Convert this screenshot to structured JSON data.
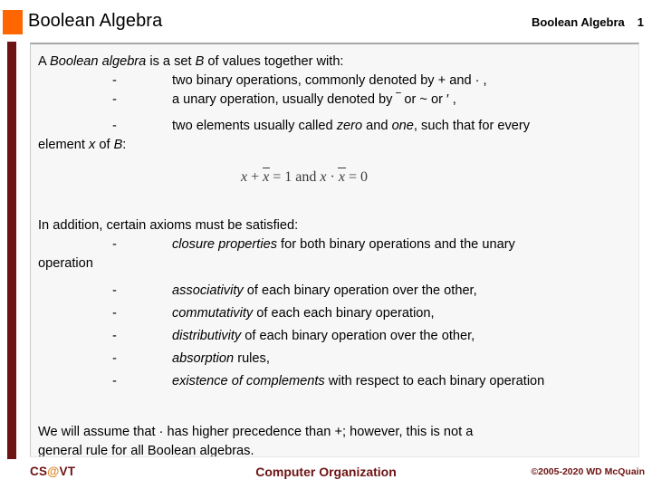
{
  "header": {
    "title": "Boolean Algebra",
    "right_label": "Boolean Algebra",
    "slide_number": "1",
    "accent_color": "#ff6600"
  },
  "decor": {
    "left_bar_color": "#6d1313"
  },
  "content": {
    "intro": {
      "lead_a": "A ",
      "lead_term": "Boolean algebra",
      "lead_b": " is a set ",
      "lead_set": "B",
      "lead_c": " of values together with:",
      "dash": "-",
      "bullets": [
        "two binary operations, commonly denoted by  + and · ,",
        "a unary operation, usually denoted by ‾ or ~ or ′ ,",
        "two elements usually called zero and one, such that for every"
      ],
      "hanging": "element x of B:"
    },
    "formula": {
      "alt": "x + x̄ = 1 and x · x̄ = 0",
      "lhs_var": "x",
      "plus": " + ",
      "lhs_bar_var": "x",
      "eq_one": " = 1 ",
      "conj": "and",
      "rhs_var": " x",
      "dot": " · ",
      "rhs_bar_var": "x",
      "eq_zero": " = 0"
    },
    "axioms": {
      "lead": "In addition, certain axioms must be satisfied:",
      "dash": "-",
      "items": [
        {
          "term": "closure properties",
          "rest": " for both binary operations and the unary"
        },
        {
          "term": "associativity",
          "rest": " of each binary operation over the other,"
        },
        {
          "term": "commutativity",
          "rest": " of each each binary operation,"
        },
        {
          "term": "distributivity",
          "rest": " of each binary operation over the other,"
        },
        {
          "term": "absorption",
          "rest": " rules,"
        },
        {
          "term": "existence of complements",
          "rest": " with respect to each binary operation"
        }
      ],
      "hanging": "operation"
    },
    "closing": {
      "line1": "We will assume that · has higher precedence than +; however, this is not a",
      "line2": "general rule for all Boolean algebras."
    }
  },
  "footer": {
    "logo_prefix": "CS",
    "logo_at": "@",
    "logo_suffix": "VT",
    "center": "Computer Organization",
    "copyright": "©2005-2020 WD McQuain",
    "color": "#6d1313"
  }
}
